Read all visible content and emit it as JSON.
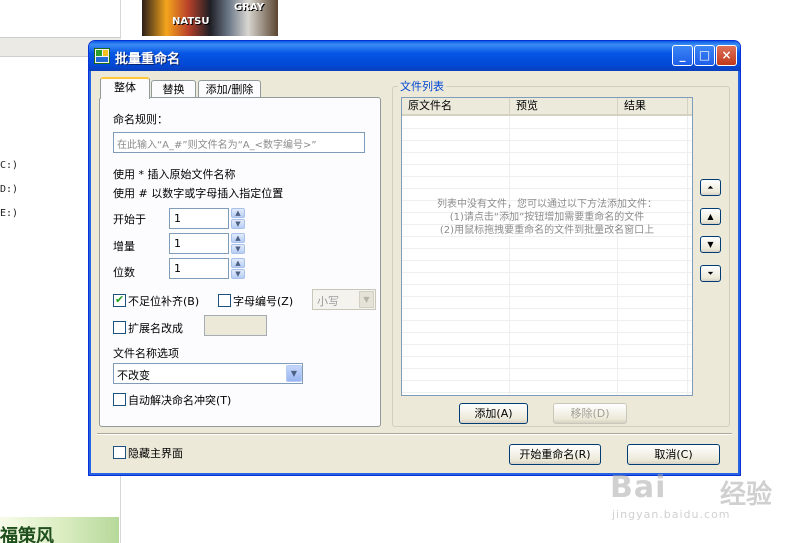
{
  "background": {
    "drives": [
      "C:)",
      "D:)",
      "E:)"
    ],
    "thumbnail_text": [
      "NATSU",
      "GRAY"
    ],
    "bottom_text": "福策风"
  },
  "watermark": {
    "main": "Bai",
    "cn": "经验",
    "sub": "jingyan.baidu.com"
  },
  "window": {
    "title": "批量重命名",
    "controls": {
      "minimize": "_",
      "maximize": "□",
      "close": "×"
    }
  },
  "tabs": [
    "整体",
    "替换",
    "添加/删除"
  ],
  "overall": {
    "rule_label": "命名规则：",
    "rule_placeholder": "在此输入“A_#”则文件名为“A_<数字编号>”",
    "hint1": "使用 * 插入原始文件名称",
    "hint2": "使用 # 以数字或字母插入指定位置",
    "start_label": "开始于",
    "start_value": "1",
    "step_label": "增量",
    "step_value": "1",
    "digits_label": "位数",
    "digits_value": "1",
    "pad_zero_label": "不足位补齐(B)",
    "pad_zero_checked": true,
    "letter_number_label": "字母编号(Z)",
    "letter_number_checked": false,
    "case_value": "小写",
    "ext_label": "扩展名改成",
    "ext_checked": false,
    "ext_value": "",
    "filename_option_label": "文件名称选项",
    "filename_option_value": "不改变",
    "auto_resolve_label": "自动解决命名冲突(T)",
    "auto_resolve_checked": false
  },
  "file_list": {
    "group_title": "文件列表",
    "columns": [
      "原文件名",
      "预览",
      "结果"
    ],
    "empty_text": [
      "列表中没有文件，您可以通过以下方法添加文件：",
      "(1)请点击“添加”按钮增加需要重命名的文件",
      "(2)用鼠标拖拽要重命名的文件到批量改名窗口上"
    ],
    "add_button": "添加(A)",
    "remove_button": "移除(D)",
    "move_buttons": [
      "move-top",
      "move-up",
      "move-down",
      "move-bottom"
    ]
  },
  "footer": {
    "hide_main_label": "隐藏主界面",
    "hide_main_checked": false,
    "start_button": "开始重命名(R)",
    "cancel_button": "取消(C)"
  },
  "colors": {
    "titlebar": "#0348d6",
    "dialog_bg": "#ece9d8",
    "tab_highlight": "#ffc83c",
    "check_mark": "#21a121"
  }
}
